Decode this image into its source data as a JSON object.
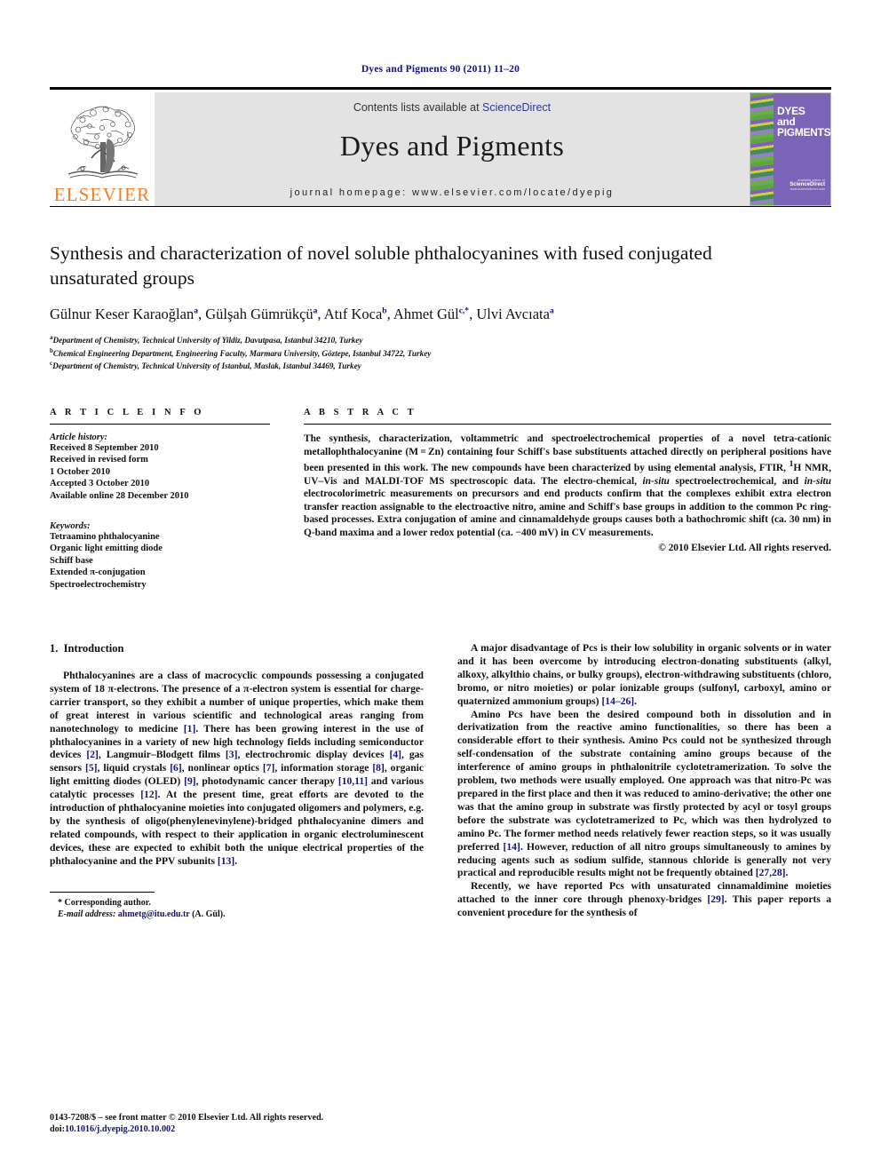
{
  "running_head": "Dyes and Pigments 90 (2011) 11–20",
  "masthead": {
    "contents_prefix": "Contents lists available at ",
    "sciencedirect": "ScienceDirect",
    "journal_title": "Dyes and Pigments",
    "homepage": "journal homepage: www.elsevier.com/locate/dyepig",
    "publisher_name": "ELSEVIER",
    "publisher_color": "#f47d20",
    "link_color": "#2b3a92"
  },
  "cover": {
    "line1": "DYES",
    "line2": "and",
    "line3": "PIGMENTS",
    "available_at": "available online at",
    "sciencedirect": "ScienceDirect",
    "url": "www.sciencedirect.com",
    "background": "#7b63b8"
  },
  "article": {
    "title": "Synthesis and characterization of novel soluble phthalocyanines with fused conjugated unsaturated groups",
    "authors": [
      {
        "name": "Gülnur Keser Karaoğlan",
        "sup": "a",
        "sep": ", "
      },
      {
        "name": "Gülşah Gümrükçü",
        "sup": "a",
        "sep": ", "
      },
      {
        "name": "Atıf Koca",
        "sup": "b",
        "sep": ", "
      },
      {
        "name": "Ahmet Gül",
        "sup": "c,*",
        "sep": ", "
      },
      {
        "name": "Ulvi Avcıata",
        "sup": "a",
        "sep": ""
      }
    ],
    "affiliations": [
      {
        "mark": "a",
        "text": "Department of Chemistry, Technical University of Yildiz, Davutpasa, Istanbul 34210, Turkey"
      },
      {
        "mark": "b",
        "text": "Chemical Engineering Department, Engineering Faculty, Marmara University, Göztepe, Istanbul 34722, Turkey"
      },
      {
        "mark": "c",
        "text": "Department of Chemistry, Technical University of Istanbul, Maslak, Istanbul 34469, Turkey"
      }
    ]
  },
  "article_info": {
    "heading": "A R T I C L E  I N F O",
    "history_label": "Article history:",
    "history": [
      "Received 8 September 2010",
      "Received in revised form",
      "1 October 2010",
      "Accepted 3 October 2010",
      "Available online 28 December 2010"
    ],
    "keywords_label": "Keywords:",
    "keywords": [
      "Tetraamino phthalocyanine",
      "Organic light emitting diode",
      "Schiff base",
      "Extended π-conjugation",
      "Spectroelectrochemistry"
    ]
  },
  "abstract": {
    "heading": "A B S T R A C T",
    "paragraph_1": "The synthesis, characterization, voltammetric and spectroelectrochemical properties of a novel tetra-cationic metallophthalocyanine (M = Zn) containing four Schiff's base substituents attached directly on peripheral positions have been presented in this work. The new compounds have been characterized by using elemental analysis, FTIR, ",
    "nmr_sup": "1",
    "paragraph_2": "H NMR, UV–Vis and MALDI-TOF MS spectroscopic data. The electro-chemical, ",
    "insitu_1": "in-situ",
    "paragraph_3": " spectroelectrochemical, and ",
    "insitu_2": "in-situ",
    "paragraph_4": " electrocolorimetric measurements on precursors and end products confirm that the complexes exhibit extra electron transfer reaction assignable to the electroactive nitro, amine and Schiff's base groups in addition to the common Pc ring-based processes. Extra conjugation of amine and cinnamaldehyde groups causes both a bathochromic shift (ca. 30 nm) in Q-band maxima and a lower redox potential (ca. −400 mV) in CV measurements.",
    "copyright": "© 2010 Elsevier Ltd. All rights reserved."
  },
  "introduction": {
    "section_number": "1.",
    "section_title": "Introduction",
    "left_paragraph_1_a": "Phthalocyanines are a class of macrocyclic compounds possessing a conjugated system of 18 π-electrons. The presence of a π-electron system is essential for charge-carrier transport, so they exhibit a number of unique properties, which make them of great interest in various scientific and technological areas ranging from nanotechnology to medicine ",
    "ref_1": "[1]",
    "left_paragraph_1_b": ". There has been growing interest in the use of phthalocyanines in a variety of new high technology fields including semiconductor devices ",
    "ref_2": "[2]",
    "left_paragraph_1_c": ", Langmuir–Blodgett films ",
    "ref_3": "[3]",
    "left_paragraph_1_d": ", electrochromic display devices ",
    "ref_4": "[4]",
    "left_paragraph_1_e": ", gas sensors ",
    "ref_5": "[5]",
    "left_paragraph_1_f": ", liquid crystals ",
    "ref_6": "[6]",
    "left_paragraph_1_g": ", nonlinear optics ",
    "ref_7": "[7]",
    "left_paragraph_1_h": ", information storage ",
    "ref_8": "[8]",
    "left_paragraph_1_i": ", organic light emitting diodes (OLED) ",
    "ref_9": "[9]",
    "left_paragraph_1_j": ", photodynamic cancer therapy ",
    "ref_10_11": "[10,11]",
    "left_paragraph_1_k": " and various catalytic processes ",
    "ref_12": "[12]",
    "left_paragraph_1_l": ". At the present time, great efforts are devoted to the introduction of phthalocyanine moieties into conjugated oligomers and polymers, e.g. by the synthesis of oligo(phenylenevinylene)-bridged phthalocyanine dimers and related compounds, with respect to their application in organic electroluminescent devices, these are expected to exhibit both the unique electrical properties of the phthalocyanine and the PPV subunits ",
    "ref_13": "[13]",
    "left_paragraph_1_m": ".",
    "right_paragraph_1_a": "A major disadvantage of Pcs is their low solubility in organic solvents or in water and it has been overcome by introducing electron-donating substituents (alkyl, alkoxy, alkylthio chains, or bulky groups), electron-withdrawing substituents (chloro, bromo, or nitro moieties) or polar ionizable groups (sulfonyl, carboxyl, amino or quaternized ammonium groups) ",
    "ref_14_26": "[14–26]",
    "right_paragraph_1_b": ".",
    "right_paragraph_2_a": "Amino Pcs have been the desired compound both in dissolution and in derivatization from the reactive amino functionalities, so there has been a considerable effort to their synthesis. Amino Pcs could not be synthesized through self-condensation of the substrate containing amino groups because of the interference of amino groups in phthalonitrile cyclotetramerization. To solve the problem, two methods were usually employed. One approach was that nitro-Pc was prepared in the first place and then it was reduced to amino-derivative; the other one was that the amino group in substrate was firstly protected by acyl or tosyl groups before the substrate was cyclotetramerized to Pc, which was then hydrolyzed to amino Pc. The former method needs relatively fewer reaction steps, so it was usually preferred ",
    "ref_14": "[14]",
    "right_paragraph_2_b": ". However, reduction of all nitro groups simultaneously to amines by reducing agents such as sodium sulfide, stannous chloride is generally not very practical and reproducible results might not be frequently obtained ",
    "ref_27_28": "[27,28]",
    "right_paragraph_2_c": ".",
    "right_paragraph_3_a": "Recently, we have reported Pcs with unsaturated cinnamaldimine moieties attached to the inner core through phenoxy-bridges ",
    "ref_29": "[29]",
    "right_paragraph_3_b": ". This paper reports a convenient procedure for the synthesis of"
  },
  "footnote": {
    "corresponding": "* Corresponding author.",
    "email_label": "E-mail address:",
    "email": "ahmetg@itu.edu.tr",
    "email_owner": "(A. Gül)."
  },
  "colophon": {
    "issn_line": "0143-7208/$ – see front matter © 2010 Elsevier Ltd. All rights reserved.",
    "doi_prefix": "doi:",
    "doi": "10.1016/j.dyepig.2010.10.002"
  }
}
